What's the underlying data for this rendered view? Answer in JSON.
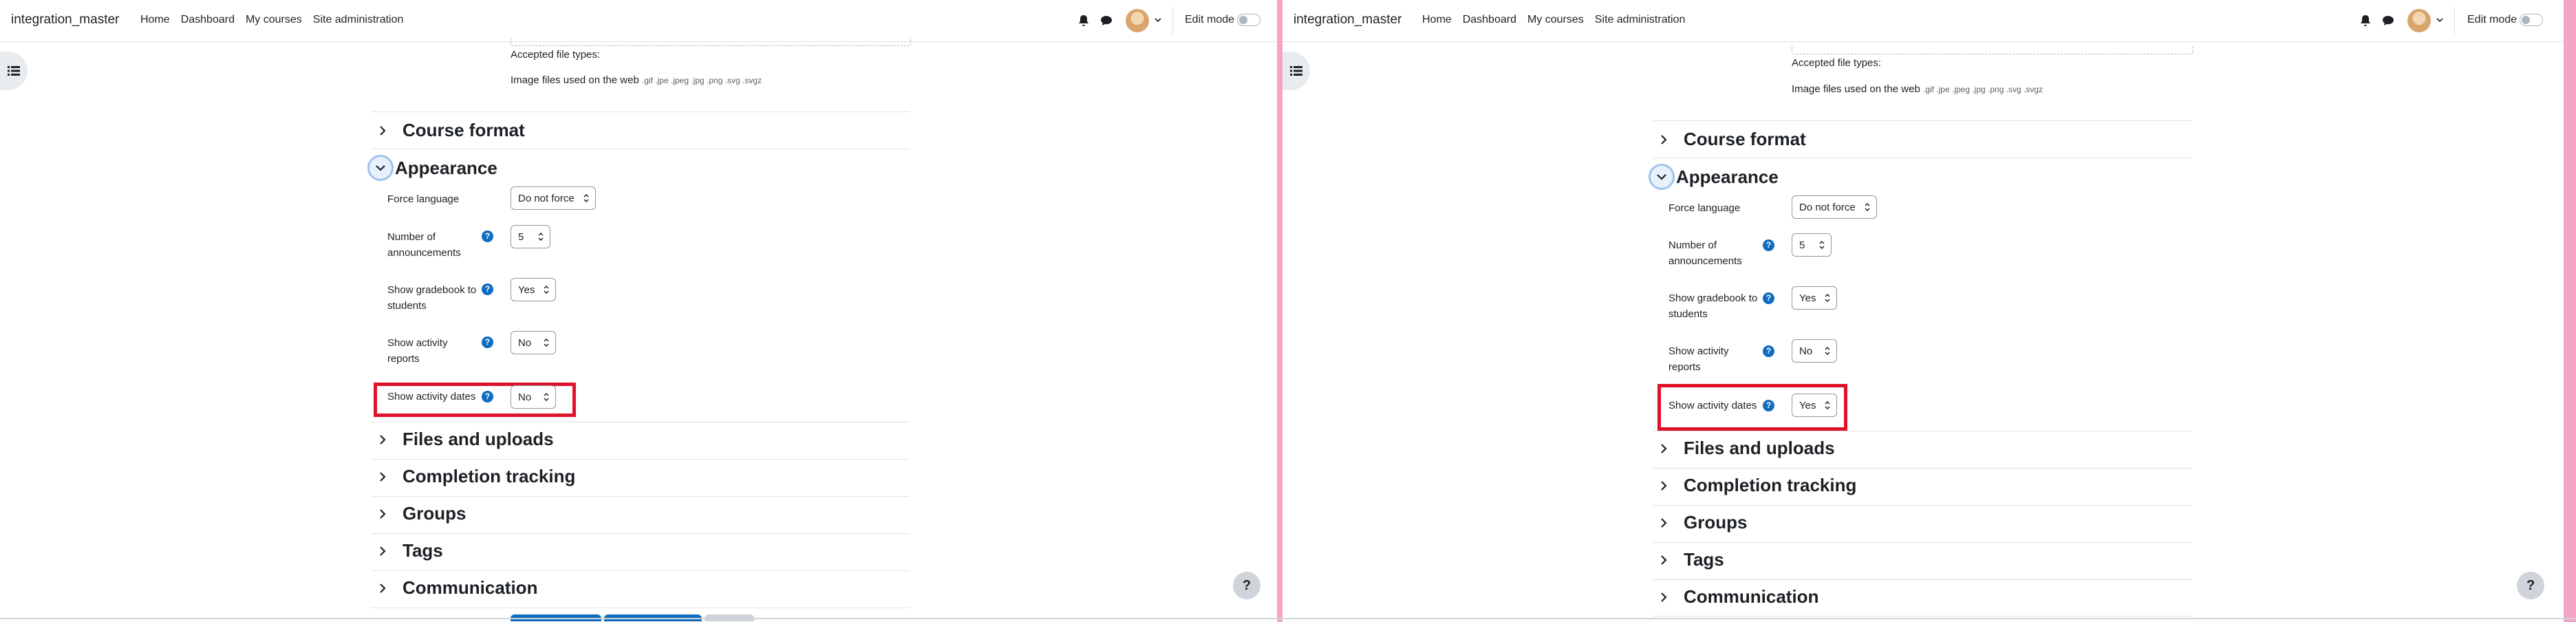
{
  "navbar": {
    "site_name": "integration_master",
    "links": [
      "Home",
      "Dashboard",
      "My courses",
      "Site administration"
    ],
    "edit_mode_label": "Edit mode"
  },
  "upload": {
    "accepted_label": "Accepted file types:",
    "image_files_label": "Image files used on the web",
    "extensions": ".gif .jpe .jpeg .jpg .png .svg .svgz"
  },
  "sections": {
    "course_format": "Course format",
    "appearance": "Appearance",
    "files_uploads": "Files and uploads",
    "completion": "Completion tracking",
    "groups": "Groups",
    "tags": "Tags",
    "communication": "Communication"
  },
  "fields": {
    "force_language": {
      "label": "Force language",
      "value": "Do not force"
    },
    "announcements": {
      "label_line1": "Number of",
      "label_line2": "announcements",
      "value": "5"
    },
    "gradebook": {
      "label_line1": "Show gradebook to",
      "label_line2": "students",
      "value": "Yes"
    },
    "activity_reports": {
      "label_line1": "Show activity",
      "label_line2": "reports",
      "value": "No"
    },
    "activity_dates": {
      "label": "Show activity dates"
    }
  },
  "left": {
    "activity_dates_value": "No"
  },
  "right": {
    "activity_dates_value": "Yes"
  },
  "help_glyph": "?",
  "colors": {
    "highlight": "#e0112a",
    "primary": "#0f6cbf",
    "separator": "#f5a5c3"
  }
}
